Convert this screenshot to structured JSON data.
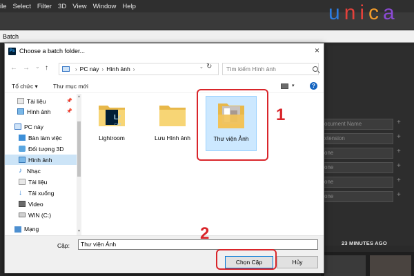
{
  "ps": {
    "menu": [
      "ile",
      "Select",
      "Filter",
      "3D",
      "View",
      "Window",
      "Help"
    ],
    "batch_title": "Batch",
    "fields": [
      "ocument Name",
      "xtension",
      "one",
      "one",
      "one",
      "one"
    ],
    "plus": "+",
    "time_label": "23 MINUTES AGO"
  },
  "logo": {
    "u": "u",
    "n": "n",
    "i": "i",
    "c": "c",
    "a": "a"
  },
  "dialog": {
    "icon_text": "Ps",
    "title": "Choose a batch folder...",
    "close": "×",
    "nav": {
      "back": "←",
      "forward": "→",
      "dd": "⌄",
      "up": "↑"
    },
    "address": {
      "segments": [
        "PC này",
        "Hình ảnh"
      ],
      "sep": "›",
      "dd": "⌄",
      "refresh": "↻"
    },
    "search_placeholder": "Tìm kiếm Hình ảnh",
    "commands": {
      "organize": "Tổ chức ▾",
      "new_folder": "Thư mục mới",
      "view_dd": "▾",
      "help": "?"
    },
    "nav_pane": [
      {
        "label": "Tài liệu",
        "icon": "documents-icon",
        "pinned": true
      },
      {
        "label": "Hình ảnh",
        "icon": "pictures-icon",
        "pinned": true
      },
      {
        "label": "PC này",
        "icon": "computer-icon"
      },
      {
        "label": "Bàn làm việc",
        "icon": "desktop-icon"
      },
      {
        "label": "Đối tượng 3D",
        "icon": "3d-objects-icon"
      },
      {
        "label": "Hình ảnh",
        "icon": "pictures-icon",
        "selected": true
      },
      {
        "label": "Nhạc",
        "icon": "music-icon"
      },
      {
        "label": "Tài liệu",
        "icon": "documents-icon"
      },
      {
        "label": "Tải xuống",
        "icon": "downloads-icon"
      },
      {
        "label": "Video",
        "icon": "videos-icon"
      },
      {
        "label": "WIN (C:)",
        "icon": "drive-icon"
      },
      {
        "label": "Mạng",
        "icon": "network-icon"
      }
    ],
    "pin_glyph": "📌",
    "folders": [
      {
        "label": "Lightroom",
        "badge_top": "Lr",
        "badge_bottom": "CAT"
      },
      {
        "label": "Lưu Hình ảnh"
      },
      {
        "label": "Thư viện Ảnh",
        "selected": true
      }
    ],
    "folder_label": "Cặp:",
    "folder_value": "Thư viện Ảnh",
    "ok_label": "Chọn Cặp",
    "cancel_label": "Hủy"
  },
  "annotations": {
    "step1": "1",
    "step2": "2"
  },
  "colors": {
    "accent": "#0078d7",
    "annotation_red": "#d9252a",
    "selection": "#cce4f7"
  }
}
